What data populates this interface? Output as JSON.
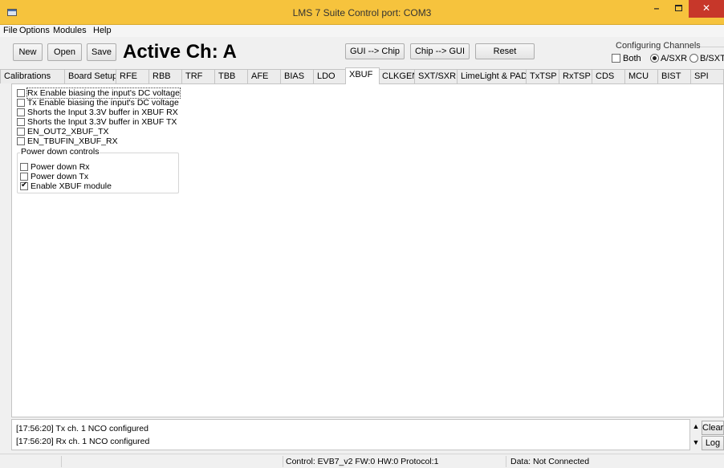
{
  "window": {
    "title": "LMS 7 Suite  Control port: COM3",
    "icon": "app-window-icon",
    "controls": [
      "minimize-icon",
      "maximize-icon",
      "close-icon"
    ]
  },
  "menu": [
    "File",
    "Options",
    "Modules",
    "Help"
  ],
  "toolbar": {
    "new_label": "New",
    "open_label": "Open",
    "save_label": "Save",
    "active_channel": "Active Ch: A",
    "gui_to_chip": "GUI --> Chip",
    "chip_to_gui": "Chip --> GUI",
    "reset": "Reset"
  },
  "config_channels": {
    "title": "Configuring Channels",
    "both": "Both",
    "a": "A/SXR",
    "b": "B/SXT",
    "selected": "A/SXR"
  },
  "tabs": [
    "Calibrations",
    "Board Setup",
    "RFE",
    "RBB",
    "TRF",
    "TBB",
    "AFE",
    "BIAS",
    "LDO",
    "XBUF",
    "CLKGEN",
    "SXT/SXR",
    "LimeLight & PAD",
    "TxTSP",
    "RxTSP",
    "CDS",
    "MCU",
    "BIST",
    "SPI"
  ],
  "active_tab": "XBUF",
  "xbuf": {
    "options": [
      {
        "label": "Rx Enable biasing the input's DC voltage",
        "checked": false
      },
      {
        "label": "Tx Enable biasing the input's DC voltage",
        "checked": false
      },
      {
        "label": "Shorts the Input 3.3V buffer in XBUF RX",
        "checked": false
      },
      {
        "label": "Shorts the Input 3.3V buffer in XBUF TX",
        "checked": false
      },
      {
        "label": "EN_OUT2_XBUF_TX",
        "checked": false
      },
      {
        "label": "EN_TBUFIN_XBUF_RX",
        "checked": false
      }
    ],
    "power_down": {
      "title": "Power down controls",
      "options": [
        {
          "label": "Power down Rx",
          "checked": false
        },
        {
          "label": "Power down Tx",
          "checked": false
        },
        {
          "label": "Enable XBUF module",
          "checked": true
        }
      ]
    }
  },
  "log": {
    "lines": [
      "[17:56:20] Tx ch. 1 NCO configured",
      "[17:56:20] Rx ch. 1 NCO configured"
    ],
    "clear_label": "Clear",
    "log_label": "Log"
  },
  "status": {
    "control": "Control: EVB7_v2  FW:0 HW:0 Protocol:1",
    "data": "Data: Not Connected"
  }
}
